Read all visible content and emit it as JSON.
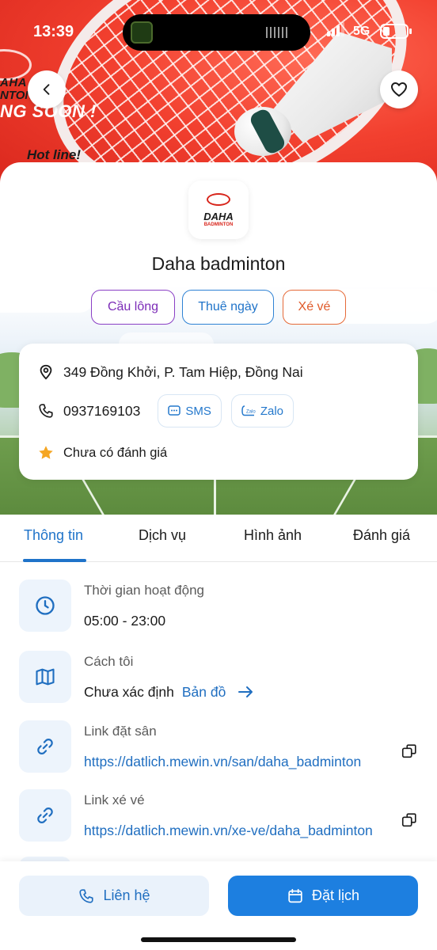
{
  "status_bar": {
    "time": "13:39",
    "network": "5G"
  },
  "banner": {
    "promo_line_1": "AHA",
    "promo_line_2": "NTON",
    "promo_line_3": "NG SOON !",
    "hotline": "Hot line!"
  },
  "venue": {
    "logo_text": "DAHA",
    "logo_subtext": "BADMINTON",
    "name": "Daha badminton",
    "tags": [
      "Cầu lông",
      "Thuê ngày",
      "Xé vé"
    ],
    "address": "349 Đồng Khởi, P. Tam Hiệp, Đồng Nai",
    "phone": "0937169103",
    "sms_label": "SMS",
    "zalo_label": "Zalo",
    "rating_text": "Chưa có đánh giá"
  },
  "tabs": [
    "Thông tin",
    "Dịch vụ",
    "Hình ảnh",
    "Đánh giá"
  ],
  "details": {
    "hours_label": "Thời gian hoạt động",
    "hours_value": "05:00 - 23:00",
    "distance_label": "Cách tôi",
    "distance_value": "Chưa xác định",
    "map_link": "Bản đồ",
    "booking_link_label": "Link đặt sân",
    "booking_link_value": "https://datlich.mewin.vn/san/daha_badminton",
    "ticket_link_label": "Link xé vé",
    "ticket_link_value": "https://datlich.mewin.vn/xe-ve/daha_badminton"
  },
  "actions": {
    "contact": "Liên hệ",
    "book": "Đặt lịch"
  },
  "colors": {
    "primary": "#1d7fe0",
    "tag_purple": "#8a3fc5",
    "tag_blue": "#2e82d4",
    "tag_orange": "#e66a38",
    "rating_star": "#f5a623"
  },
  "icons": [
    "chevron-left-icon",
    "heart-icon",
    "location-pin-icon",
    "phone-icon",
    "sms-icon",
    "zalo-icon",
    "star-icon",
    "clock-icon",
    "map-icon",
    "link-icon",
    "copy-icon",
    "calendar-icon"
  ]
}
